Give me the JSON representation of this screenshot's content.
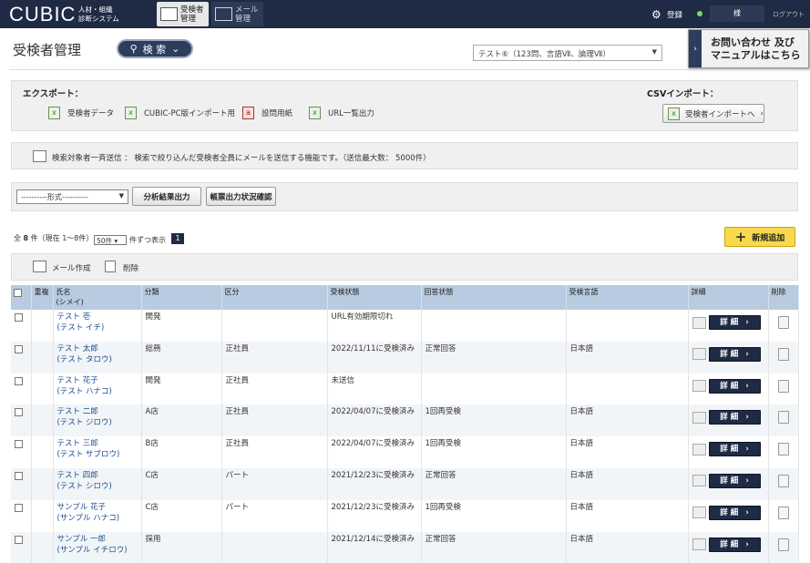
{
  "header": {
    "logo": "CUBIC",
    "logo_sub1": "人材・組織",
    "logo_sub2": "診断システム",
    "tab_candidates_1": "受検者",
    "tab_candidates_2": "管理",
    "tab_mail_1": "メール",
    "tab_mail_2": "管理",
    "register": "登録",
    "user": "様",
    "logout": "ログアウト"
  },
  "page": {
    "title": "受検者管理",
    "search_label": "検 索",
    "test_select": "テスト⑥（123問、言語Ⅶ、論理Ⅶ）",
    "contact_1": "お問い合わせ 及び",
    "contact_2": "マニュアルはこちら"
  },
  "export": {
    "label": "エクスポート：",
    "items": [
      "受検者データ",
      "CUBIC-PC版インポート用",
      "設問用紙",
      "URL一覧出力"
    ],
    "csv_label": "CSVインポート：",
    "csv_button": "受検者インポートへ"
  },
  "mail_bulk": {
    "text": "検索対象者一斉送信 ： 検索で絞り込んだ受検者全員にメールを送信する機能です。（送信最大数： 5000件）"
  },
  "format": {
    "select": "----------形式----------",
    "btn_analysis": "分析結果出力",
    "btn_status": "帳票出力状況確認"
  },
  "listing": {
    "count_prefix": "全",
    "count": "8",
    "count_suffix": "件（現在 1〜8件）",
    "per_page": "50件",
    "per_label": "件ずつ表示",
    "page": "1",
    "new_button": "新規追加",
    "mail_create": "メール作成",
    "delete": "削除"
  },
  "table": {
    "headers": {
      "dup": "重複",
      "name_1": "氏名",
      "name_2": "(シメイ)",
      "category": "分類",
      "division": "区分",
      "exam_status": "受検状態",
      "answer_status": "回答状態",
      "exam_language": "受検言語",
      "detail": "詳細",
      "del": "削除"
    },
    "detail_label": "詳 細",
    "rows": [
      {
        "name": "テスト 壱",
        "kana": "(テスト イチ)",
        "category": "開発",
        "division": "",
        "exam_status": "URL有効期限切れ",
        "answer_status": "",
        "language": ""
      },
      {
        "name": "テスト 太郎",
        "kana": "(テスト タロウ)",
        "category": "総務",
        "division": "正社員",
        "exam_status": "2022/11/11に受検済み",
        "answer_status": "正常回答",
        "language": "日本語"
      },
      {
        "name": "テスト 花子",
        "kana": "(テスト ハナコ)",
        "category": "開発",
        "division": "正社員",
        "exam_status": "未送信",
        "answer_status": "",
        "language": ""
      },
      {
        "name": "テスト 二郎",
        "kana": "(テスト ジロウ)",
        "category": "A店",
        "division": "正社員",
        "exam_status": "2022/04/07に受検済み",
        "answer_status": "1回再受検",
        "language": "日本語"
      },
      {
        "name": "テスト 三郎",
        "kana": "(テスト サブロウ)",
        "category": "B店",
        "division": "正社員",
        "exam_status": "2022/04/07に受検済み",
        "answer_status": "1回再受検",
        "language": "日本語"
      },
      {
        "name": "テスト 四郎",
        "kana": "(テスト シロウ)",
        "category": "C店",
        "division": "パート",
        "exam_status": "2021/12/23に受検済み",
        "answer_status": "正常回答",
        "language": "日本語"
      },
      {
        "name": "サンプル 花子",
        "kana": "(サンプル ハナコ)",
        "category": "C店",
        "division": "パート",
        "exam_status": "2021/12/23に受検済み",
        "answer_status": "1回再受検",
        "language": "日本語"
      },
      {
        "name": "サンプル 一郎",
        "kana": "(サンプル イチロウ)",
        "category": "採用",
        "division": "",
        "exam_status": "2021/12/14に受検済み",
        "answer_status": "正常回答",
        "language": "日本語"
      }
    ]
  }
}
